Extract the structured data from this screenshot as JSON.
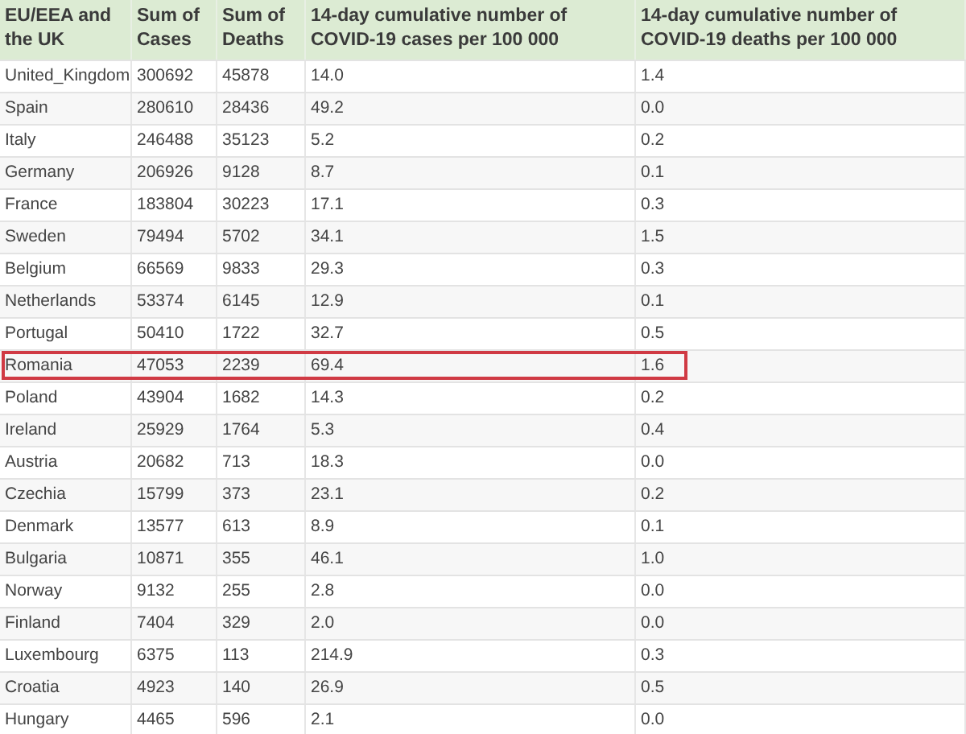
{
  "table": {
    "columns": [
      "EU/EEA and the UK",
      "Sum of Cases",
      "Sum of Deaths",
      "14-day cumulative number of COVID-19 cases per 100 000",
      "14-day cumulative number of COVID-19 deaths per 100 000"
    ],
    "rows": [
      {
        "cells": [
          "United_Kingdom",
          "300692",
          "45878",
          "14.0",
          "1.4"
        ],
        "highlighted": false
      },
      {
        "cells": [
          "Spain",
          "280610",
          "28436",
          "49.2",
          "0.0"
        ],
        "highlighted": false
      },
      {
        "cells": [
          "Italy",
          "246488",
          "35123",
          "5.2",
          "0.2"
        ],
        "highlighted": false
      },
      {
        "cells": [
          "Germany",
          "206926",
          "9128",
          "8.7",
          "0.1"
        ],
        "highlighted": false
      },
      {
        "cells": [
          "France",
          "183804",
          "30223",
          "17.1",
          "0.3"
        ],
        "highlighted": false
      },
      {
        "cells": [
          "Sweden",
          "79494",
          "5702",
          "34.1",
          "1.5"
        ],
        "highlighted": false
      },
      {
        "cells": [
          "Belgium",
          "66569",
          "9833",
          "29.3",
          "0.3"
        ],
        "highlighted": false
      },
      {
        "cells": [
          "Netherlands",
          "53374",
          "6145",
          "12.9",
          "0.1"
        ],
        "highlighted": false
      },
      {
        "cells": [
          "Portugal",
          "50410",
          "1722",
          "32.7",
          "0.5"
        ],
        "highlighted": false
      },
      {
        "cells": [
          "Romania",
          "47053",
          "2239",
          "69.4",
          "1.6"
        ],
        "highlighted": true
      },
      {
        "cells": [
          "Poland",
          "43904",
          "1682",
          "14.3",
          "0.2"
        ],
        "highlighted": false
      },
      {
        "cells": [
          "Ireland",
          "25929",
          "1764",
          "5.3",
          "0.4"
        ],
        "highlighted": false
      },
      {
        "cells": [
          "Austria",
          "20682",
          "713",
          "18.3",
          "0.0"
        ],
        "highlighted": false
      },
      {
        "cells": [
          "Czechia",
          "15799",
          "373",
          "23.1",
          "0.2"
        ],
        "highlighted": false
      },
      {
        "cells": [
          "Denmark",
          "13577",
          "613",
          "8.9",
          "0.1"
        ],
        "highlighted": false
      },
      {
        "cells": [
          "Bulgaria",
          "10871",
          "355",
          "46.1",
          "1.0"
        ],
        "highlighted": false
      },
      {
        "cells": [
          "Norway",
          "9132",
          "255",
          "2.8",
          "0.0"
        ],
        "highlighted": false
      },
      {
        "cells": [
          "Finland",
          "7404",
          "329",
          "2.0",
          "0.0"
        ],
        "highlighted": false
      },
      {
        "cells": [
          "Luxembourg",
          "6375",
          "113",
          "214.9",
          "0.3"
        ],
        "highlighted": false
      },
      {
        "cells": [
          "Croatia",
          "4923",
          "140",
          "26.9",
          "0.5"
        ],
        "highlighted": false
      },
      {
        "cells": [
          "Hungary",
          "4465",
          "596",
          "2.1",
          "0.0"
        ],
        "highlighted": false
      }
    ]
  }
}
